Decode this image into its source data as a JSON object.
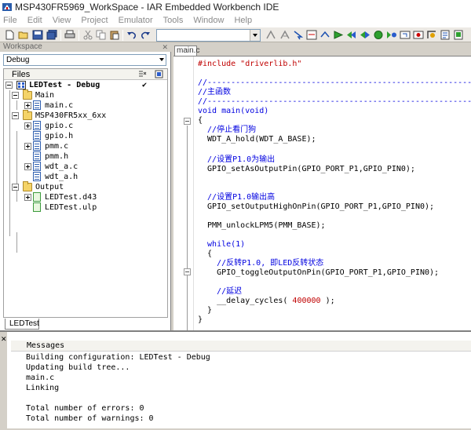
{
  "window": {
    "title": "MSP430FR5969_WorkSpace - IAR Embedded Workbench IDE"
  },
  "menu": [
    "File",
    "Edit",
    "View",
    "Project",
    "Emulator",
    "Tools",
    "Window",
    "Help"
  ],
  "toolbar": {
    "combo_value": ""
  },
  "workspace": {
    "header": "Workspace",
    "config": "Debug",
    "files_label": "Files",
    "tab": "LEDTest",
    "tree": [
      {
        "label": "LEDTest - Debug",
        "type": "project",
        "checked": "✔"
      },
      {
        "label": "Main",
        "type": "folder"
      },
      {
        "label": "main.c",
        "type": "cfile"
      },
      {
        "label": "MSP430FR5xx_6xx",
        "type": "folder"
      },
      {
        "label": "gpio.c",
        "type": "cfile"
      },
      {
        "label": "gpio.h",
        "type": "cfile"
      },
      {
        "label": "pmm.c",
        "type": "cfile"
      },
      {
        "label": "pmm.h",
        "type": "cfile"
      },
      {
        "label": "wdt_a.c",
        "type": "cfile"
      },
      {
        "label": "wdt_a.h",
        "type": "cfile"
      },
      {
        "label": "Output",
        "type": "folder"
      },
      {
        "label": "LEDTest.d43",
        "type": "output"
      },
      {
        "label": "LEDTest.ulp",
        "type": "output"
      }
    ]
  },
  "editor": {
    "tab": "main.c",
    "lines": [
      {
        "text": "#include \"driverlib.h\"",
        "cls": "c-pre"
      },
      {
        "text": "",
        "cls": "c-txt"
      },
      {
        "text": "//-----------------------------------------------------------",
        "cls": "c-cmt"
      },
      {
        "text": "//主函数",
        "cls": "c-cmt"
      },
      {
        "text": "//-----------------------------------------------------------",
        "cls": "c-cmt"
      },
      {
        "text": "void main(void)",
        "cls": "c-kw"
      },
      {
        "text": "{",
        "cls": "c-txt"
      },
      {
        "text": "  //停止看门狗",
        "cls": "c-cmt"
      },
      {
        "text": "  WDT_A_hold(WDT_A_BASE);",
        "cls": "c-txt"
      },
      {
        "text": "",
        "cls": "c-txt"
      },
      {
        "text": "  //设置P1.0为输出",
        "cls": "c-cmt"
      },
      {
        "text": "  GPIO_setAsOutputPin(GPIO_PORT_P1,GPIO_PIN0);",
        "cls": "c-txt"
      },
      {
        "text": "",
        "cls": "c-txt"
      },
      {
        "text": "",
        "cls": "c-txt"
      },
      {
        "text": "  //设置P1.0输出高",
        "cls": "c-cmt"
      },
      {
        "text": "  GPIO_setOutputHighOnPin(GPIO_PORT_P1,GPIO_PIN0);",
        "cls": "c-txt"
      },
      {
        "text": "",
        "cls": "c-txt"
      },
      {
        "text": "  PMM_unlockLPM5(PMM_BASE);",
        "cls": "c-txt"
      },
      {
        "text": "",
        "cls": "c-txt"
      },
      {
        "text": "  while(1)",
        "cls": "c-kw"
      },
      {
        "text": "  {",
        "cls": "c-txt"
      },
      {
        "text": "    //反转P1.0, 即LED反转状态",
        "cls": "c-cmt"
      },
      {
        "text": "    GPIO_toggleOutputOnPin(GPIO_PORT_P1,GPIO_PIN0);",
        "cls": "c-txt"
      },
      {
        "text": "",
        "cls": "c-txt"
      },
      {
        "text": "    //延迟",
        "cls": "c-cmt"
      },
      {
        "text": "    __delay_cycles( ",
        "cls": "c-txt",
        "num": "400000",
        "tail": " );"
      },
      {
        "text": "  }",
        "cls": "c-txt"
      },
      {
        "text": "}",
        "cls": "c-txt"
      }
    ]
  },
  "messages": {
    "header": "Messages",
    "lines": [
      "Building configuration: LEDTest - Debug",
      "Updating build tree...",
      "main.c",
      "Linking",
      "",
      "Total number of errors: 0",
      "Total number of warnings: 0"
    ]
  }
}
